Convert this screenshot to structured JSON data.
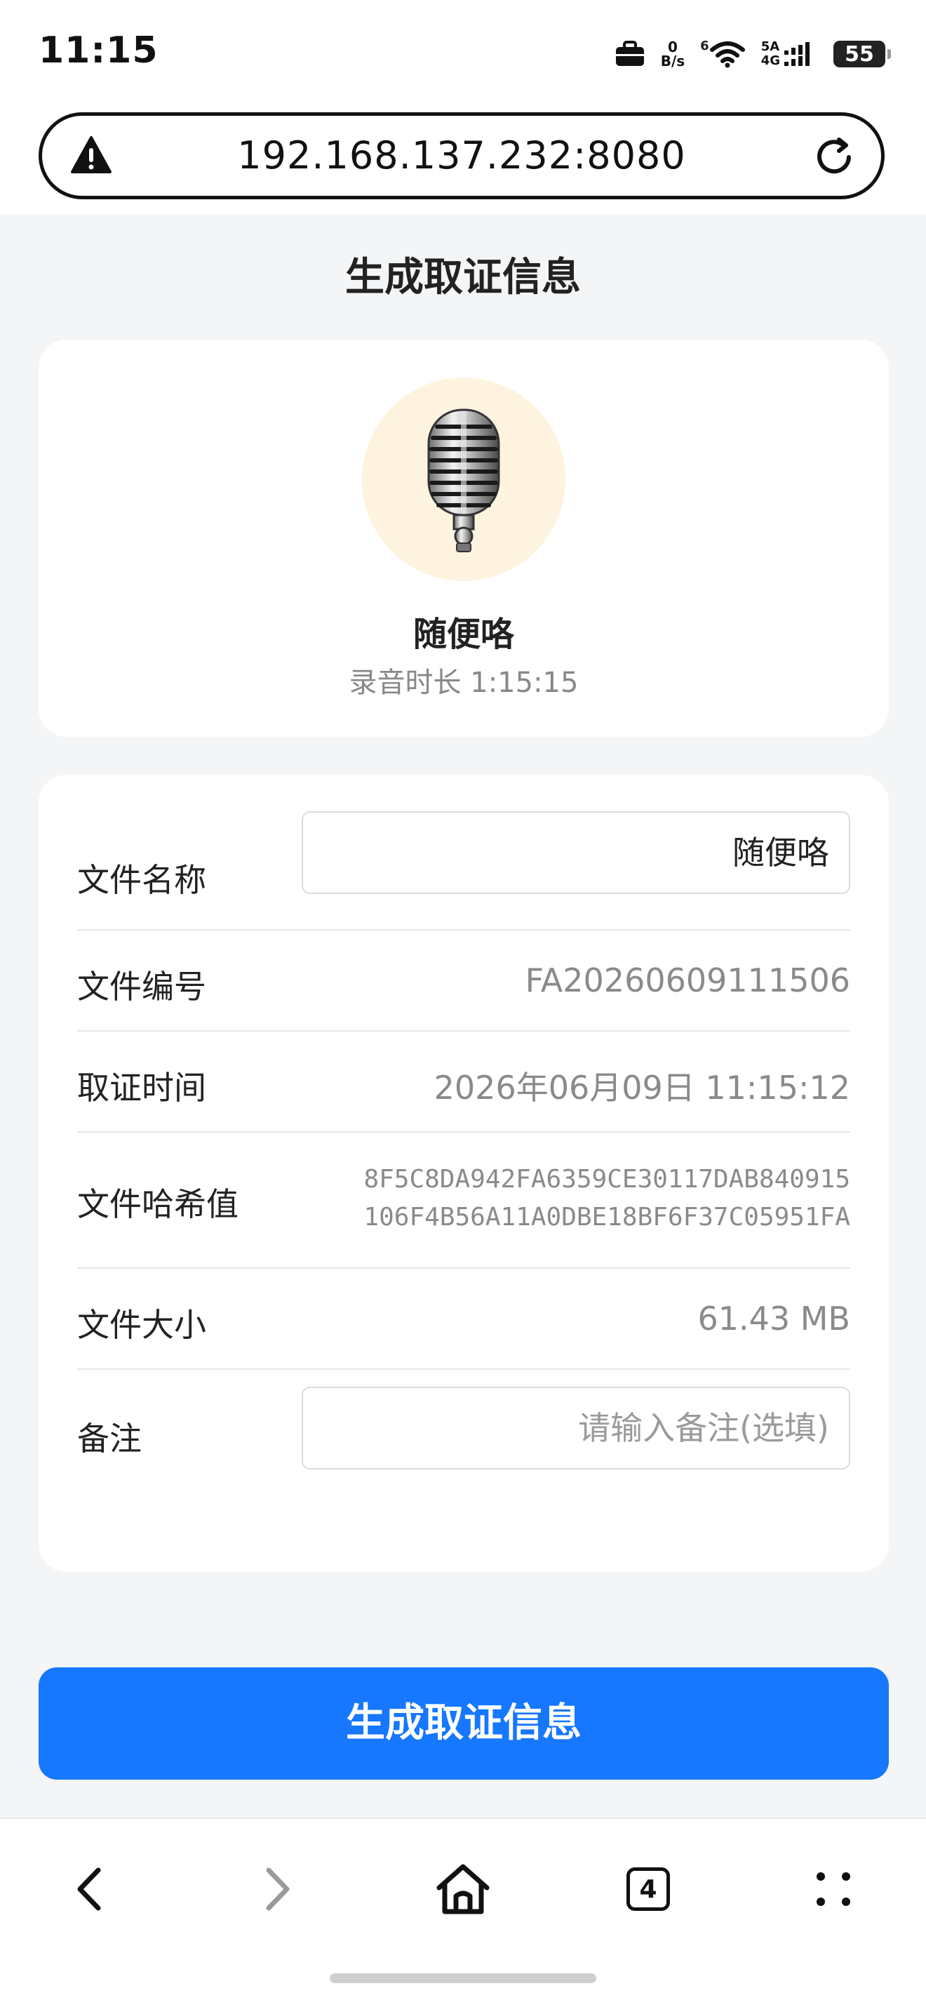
{
  "status_bar": {
    "time": "11:15",
    "net_speed_value": "0",
    "net_speed_unit": "B/s",
    "wifi_badge": "6",
    "signal_labels": "5A\n4G",
    "battery": "55"
  },
  "browser": {
    "url": "192.168.137.232:8080",
    "tab_count": "4"
  },
  "page": {
    "title": "生成取证信息",
    "recording": {
      "name": "随便咯",
      "duration": "录音时长 1:15:15"
    },
    "fields": {
      "file_name": {
        "label": "文件名称",
        "value": "随便咯"
      },
      "file_number": {
        "label": "文件编号",
        "value": "FA20260609111506"
      },
      "forensic_time": {
        "label": "取证时间",
        "value": "2026年06月09日 11:15:12"
      },
      "file_hash": {
        "label": "文件哈希值",
        "line1": "8F5C8DA942FA6359CE30117DAB840915",
        "line2": "106F4B56A11A0DBE18BF6F37C05951FA"
      },
      "file_size": {
        "label": "文件大小",
        "value": "61.43 MB"
      },
      "remark": {
        "label": "备注",
        "placeholder": "请输入备注(选填)"
      }
    },
    "submit_label": "生成取证信息"
  },
  "colors": {
    "primary": "#1677ff",
    "avatar_bg": "#fdf3df",
    "page_bg": "#f4f5f7"
  },
  "icons": [
    "warning-icon",
    "reload-icon",
    "microphone-icon",
    "back-icon",
    "forward-icon",
    "home-icon",
    "tabs-icon",
    "menu-icon",
    "briefcase-icon",
    "wifi-icon"
  ]
}
